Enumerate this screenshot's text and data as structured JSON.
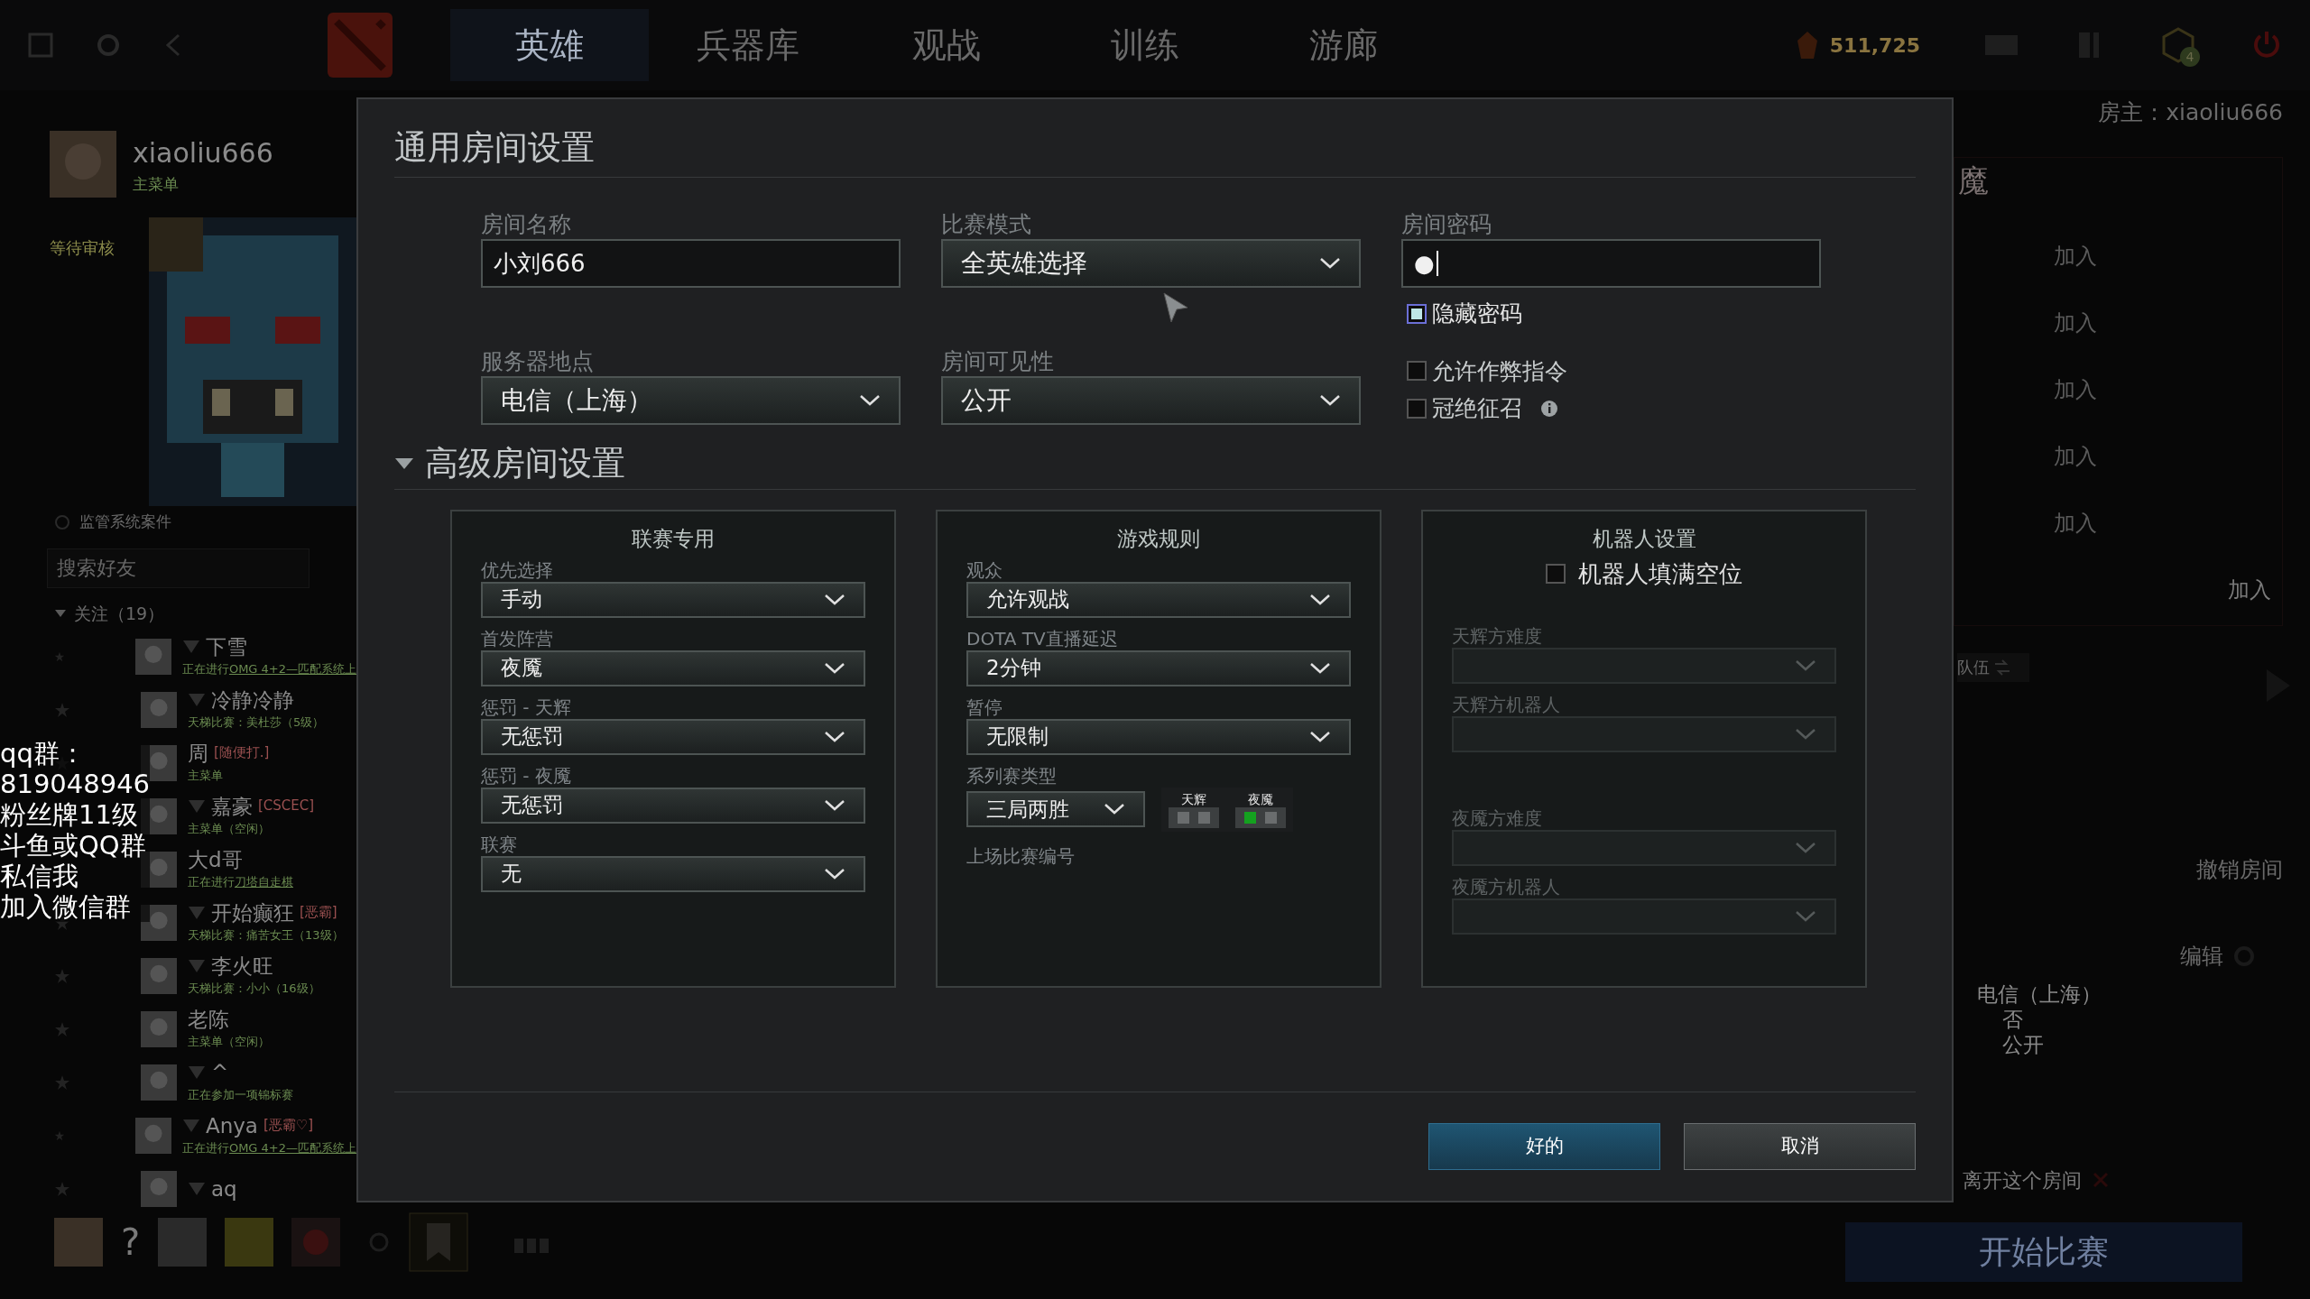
{
  "top_bar": {
    "tabs": [
      {
        "label": "英雄",
        "selected": true
      },
      {
        "label": "兵器库",
        "selected": false
      },
      {
        "label": "观战",
        "selected": false
      },
      {
        "label": "训练",
        "selected": false
      },
      {
        "label": "游廊",
        "selected": false
      }
    ],
    "currency": "511,725",
    "badge": "4"
  },
  "profile": {
    "name": "xiaoliu666",
    "status": "主菜单",
    "notice": "等待审核"
  },
  "sidebar": {
    "report": "监管系统案件",
    "search_placeholder": "搜索好友",
    "group": "关注（19）",
    "friends": [
      {
        "name": "下雪",
        "ranked": true,
        "status": "正在进行",
        "game": "OMG 4+2—匹配系统上"
      },
      {
        "name": "冷静冷静",
        "ranked": true,
        "status": "天梯比赛：美杜莎（5级）"
      },
      {
        "name": "周",
        "tag": "[随便打.]",
        "ranked": false,
        "status": "主菜单"
      },
      {
        "name": "嘉豪",
        "tag": "[CSCEC]",
        "ranked": true,
        "status": "主菜单（空闲）"
      },
      {
        "name": "大d哥",
        "ranked": false,
        "status": "正在进行",
        "game": "刀塔自走棋"
      },
      {
        "name": "开始癫狂",
        "tag": "[恶霸]",
        "ranked": true,
        "status": "天梯比赛：痛苦女王（13级）"
      },
      {
        "name": "李火旺",
        "ranked": true,
        "status": "天梯比赛：小小（16级）"
      },
      {
        "name": "老陈",
        "ranked": false,
        "status": "主菜单（空闲）"
      },
      {
        "name": "^",
        "ranked": true,
        "status": "正在参加一项锦标赛"
      },
      {
        "name": "Anya",
        "tag": "[恶霸♡]",
        "ranked": true,
        "status": "正在进行",
        "game": "OMG 4+2—匹配系统上"
      },
      {
        "name": "aq",
        "ranked": true
      }
    ]
  },
  "overlay": {
    "lines": [
      "qq群：",
      "819048946",
      "粉丝牌11级",
      "斗鱼或QQ群",
      "私信我",
      "加入微信群"
    ]
  },
  "bottom_bar": {
    "help": "?"
  },
  "lobby": {
    "host": "房主：xiaoliu666",
    "team_header": "魔",
    "join": [
      "加入",
      "加入",
      "加入",
      "加入",
      "加入",
      "加入"
    ],
    "team_swap": "队伍",
    "cancel_room": "撤销房间",
    "edit": "编辑",
    "info": [
      "电信（上海）",
      "否",
      "公开"
    ],
    "leave": "离开这个房间",
    "start": "开始比赛"
  },
  "dialog": {
    "title": "通用房间设置",
    "fields": [
      {
        "kind": "input",
        "label": "房间名称",
        "value": "小刘666"
      },
      {
        "kind": "select",
        "label": "比赛模式",
        "value": "全英雄选择"
      },
      {
        "kind": "input",
        "label": "房间密码",
        "value": "●"
      },
      {
        "kind": "select",
        "label": "服务器地点",
        "value": "电信（上海）"
      },
      {
        "kind": "select",
        "label": "房间可见性",
        "value": "公开"
      }
    ],
    "hide_password": {
      "label": "隐藏密码",
      "checked": true
    },
    "options": [
      {
        "label": "允许作弊指令",
        "checked": false,
        "info": false
      },
      {
        "label": "冠绝征召",
        "checked": false,
        "info": true
      }
    ],
    "advanced": {
      "title": "高级房间设置",
      "expanded": true,
      "panels": [
        {
          "title": "联赛专用",
          "items": [
            {
              "kind": "select",
              "label": "优先选择",
              "value": "手动"
            },
            {
              "kind": "select",
              "label": "首发阵营",
              "value": "夜魇"
            },
            {
              "kind": "select",
              "label": "惩罚 - 天辉",
              "value": "无惩罚"
            },
            {
              "kind": "select",
              "label": "惩罚 - 夜魇",
              "value": "无惩罚"
            },
            {
              "kind": "select",
              "label": "联赛",
              "value": "无"
            }
          ]
        },
        {
          "title": "游戏规则",
          "items": [
            {
              "kind": "select",
              "label": "观众",
              "value": "允许观战"
            },
            {
              "kind": "select",
              "label": "DOTA TV直播延迟",
              "value": "2分钟"
            },
            {
              "kind": "select",
              "label": "暂停",
              "value": "无限制"
            },
            {
              "kind": "series",
              "label": "系列赛类型",
              "value": "三局两胜",
              "teams": [
                {
                  "name": "天辉",
                  "games": [
                    {
                      "won": false
                    },
                    {
                      "won": false
                    }
                  ]
                },
                {
                  "name": "夜魇",
                  "games": [
                    {
                      "won": true
                    },
                    {
                      "won": false
                    }
                  ]
                }
              ]
            },
            {
              "kind": "text",
              "label": "上场比赛编号"
            }
          ]
        },
        {
          "title": "机器人设置",
          "checkbox": {
            "label": "机器人填满空位",
            "checked": false
          },
          "items": [
            {
              "kind": "select",
              "label": "天辉方难度",
              "disabled": true
            },
            {
              "kind": "select",
              "label": "天辉方机器人",
              "disabled": true
            },
            {
              "kind": "gap"
            },
            {
              "kind": "select",
              "label": "夜魇方难度",
              "disabled": true
            },
            {
              "kind": "select",
              "label": "夜魇方机器人",
              "disabled": true
            }
          ]
        }
      ]
    },
    "buttons": [
      {
        "label": "好的",
        "kind": "primary"
      },
      {
        "label": "取消",
        "kind": "secondary"
      }
    ]
  }
}
